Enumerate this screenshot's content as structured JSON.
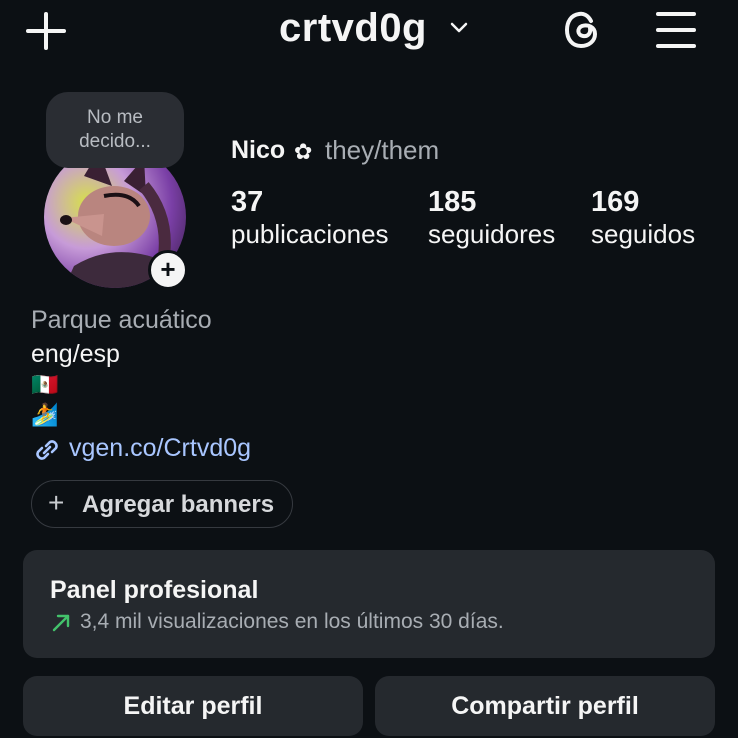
{
  "header": {
    "username": "crtvd0g"
  },
  "note": {
    "line1": "No me",
    "line2": "decido..."
  },
  "profile": {
    "display_name": "Nico",
    "name_symbol": "✿",
    "pronouns": "they/them"
  },
  "stats": [
    {
      "value": "37",
      "label": "publicaciones"
    },
    {
      "value": "185",
      "label": "seguidores"
    },
    {
      "value": "169",
      "label": "seguidos"
    }
  ],
  "bio": {
    "category": "Parque acuático",
    "line1": "eng/esp",
    "flag": "🇲🇽",
    "surf": "🏄",
    "link": "vgen.co/Crtvd0g"
  },
  "banners": {
    "label": "Agregar banners"
  },
  "panel": {
    "title": "Panel profesional",
    "subtitle": "3,4 mil visualizaciones en los últimos 30 días."
  },
  "buttons": {
    "edit": "Editar perfil",
    "share": "Compartir perfil"
  }
}
